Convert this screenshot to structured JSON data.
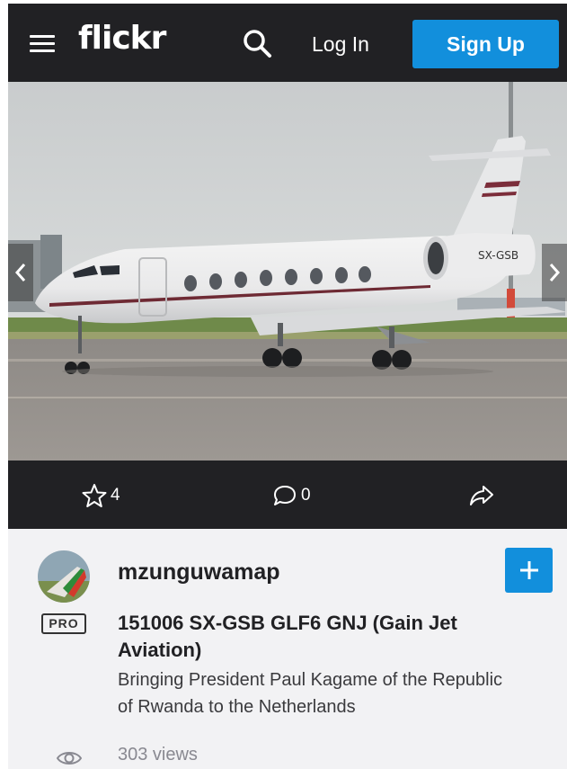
{
  "header": {
    "logo": "flickr",
    "login_label": "Log In",
    "signup_label": "Sign Up",
    "icons": {
      "menu": "hamburger-menu-icon",
      "search": "search-icon"
    }
  },
  "photo": {
    "aircraft_registration": "SX-GSB",
    "nav_icons": {
      "prev": "chevron-left-icon",
      "next": "chevron-right-icon"
    }
  },
  "actions": {
    "favorites_count": "4",
    "comments_count": "0",
    "icons": {
      "favorite": "star-icon",
      "comment": "comment-bubble-icon",
      "share": "share-arrow-icon"
    }
  },
  "owner": {
    "username": "mzunguwamap",
    "badge": "PRO",
    "follow_icon": "plus-icon"
  },
  "photo_info": {
    "title": "151006 SX-GSB GLF6 GNJ (Gain Jet Aviation)",
    "description": "Bringing President Paul Kagame of the Republic of Rwanda to the Netherlands",
    "views": "303 views",
    "views_icon": "eye-icon"
  },
  "colors": {
    "header_bg": "#212124",
    "accent_blue": "#128fdc",
    "info_bg": "#f2f2f4"
  }
}
